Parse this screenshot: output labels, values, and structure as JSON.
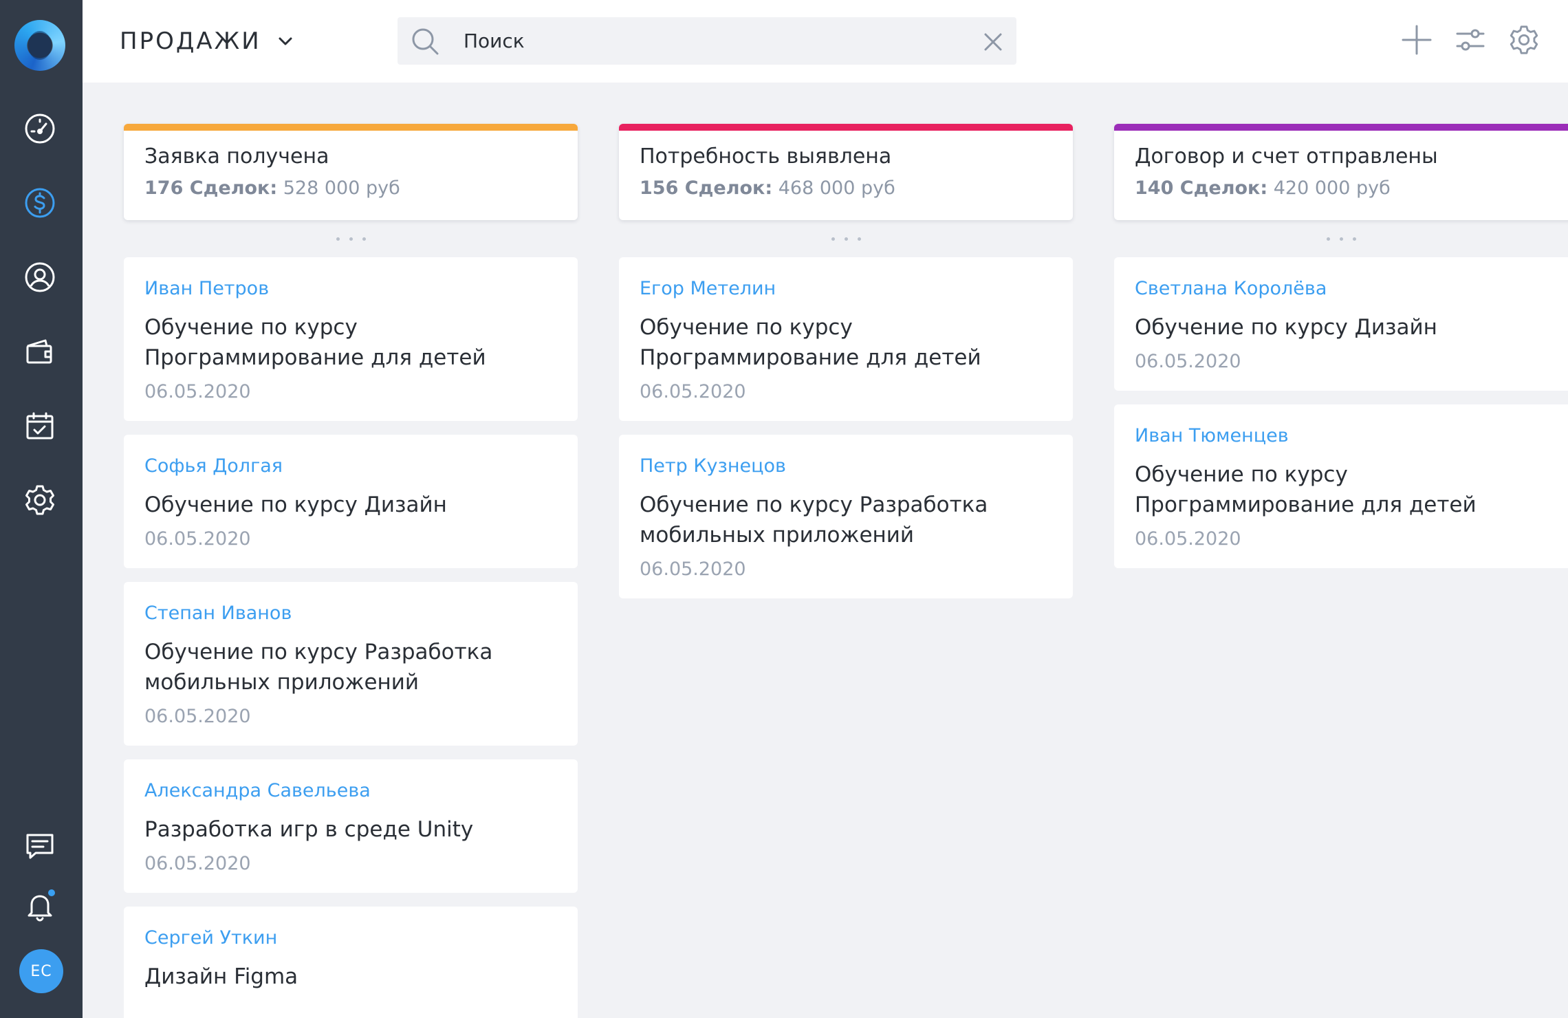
{
  "header": {
    "section_label": "ПРОДАЖИ",
    "search_placeholder": "Поиск"
  },
  "sidebar": {
    "avatar_initials": "ЕС",
    "notification_dot_color": "#3aa0f2",
    "items": [
      {
        "icon": "dashboard-gauge-icon",
        "active": false
      },
      {
        "icon": "dollar-icon",
        "active": true
      },
      {
        "icon": "user-circle-icon",
        "active": false
      },
      {
        "icon": "wallet-icon",
        "active": false
      },
      {
        "icon": "calendar-check-icon",
        "active": false
      },
      {
        "icon": "gear-icon",
        "active": false
      },
      {
        "icon": "chat-icon",
        "active": false
      },
      {
        "icon": "bell-icon",
        "active": false
      }
    ]
  },
  "colors": {
    "accent": "#3c9ef0",
    "sidebar_bg": "#323b48",
    "stage_1": "#f7a83c",
    "stage_2": "#e8215f",
    "stage_3": "#9b2db8"
  },
  "columns": [
    {
      "title": "Заявка получена",
      "deals_label": "176 Сделок:",
      "amount": "528 000 руб",
      "cards": [
        {
          "name": "Иван Петров",
          "deal_lines": [
            "Обучение по курсу",
            "Программирование для детей"
          ],
          "date": "06.05.2020"
        },
        {
          "name": "Софья Долгая",
          "deal_lines": [
            "Обучение по курсу Дизайн"
          ],
          "date": "06.05.2020"
        },
        {
          "name": "Степан Иванов",
          "deal_lines": [
            "Обучение по курсу Разработка",
            "мобильных приложений"
          ],
          "date": "06.05.2020"
        },
        {
          "name": "Александра Савельева",
          "deal_lines": [
            "Разработка игр в среде Unity"
          ],
          "date": "06.05.2020"
        },
        {
          "name": "Сергей Уткин",
          "deal_lines": [
            "Дизайн Figma"
          ],
          "date": ""
        }
      ]
    },
    {
      "title": "Потребность выявлена",
      "deals_label": "156 Сделок:",
      "amount": "468 000 руб",
      "cards": [
        {
          "name": "Егор Метелин",
          "deal_lines": [
            "Обучение по курсу",
            "Программирование для детей"
          ],
          "date": "06.05.2020"
        },
        {
          "name": "Петр Кузнецов",
          "deal_lines": [
            "Обучение по курсу Разработка",
            "мобильных приложений"
          ],
          "date": "06.05.2020"
        }
      ]
    },
    {
      "title": "Договор и счет отправлены",
      "deals_label": "140 Сделок:",
      "amount": "420 000 руб",
      "cards": [
        {
          "name": "Светлана Королёва",
          "deal_lines": [
            "Обучение по курсу Дизайн"
          ],
          "date": "06.05.2020"
        },
        {
          "name": "Иван Тюменцев",
          "deal_lines": [
            "Обучение по курсу",
            "Программирование для детей"
          ],
          "date": "06.05.2020"
        }
      ]
    }
  ]
}
